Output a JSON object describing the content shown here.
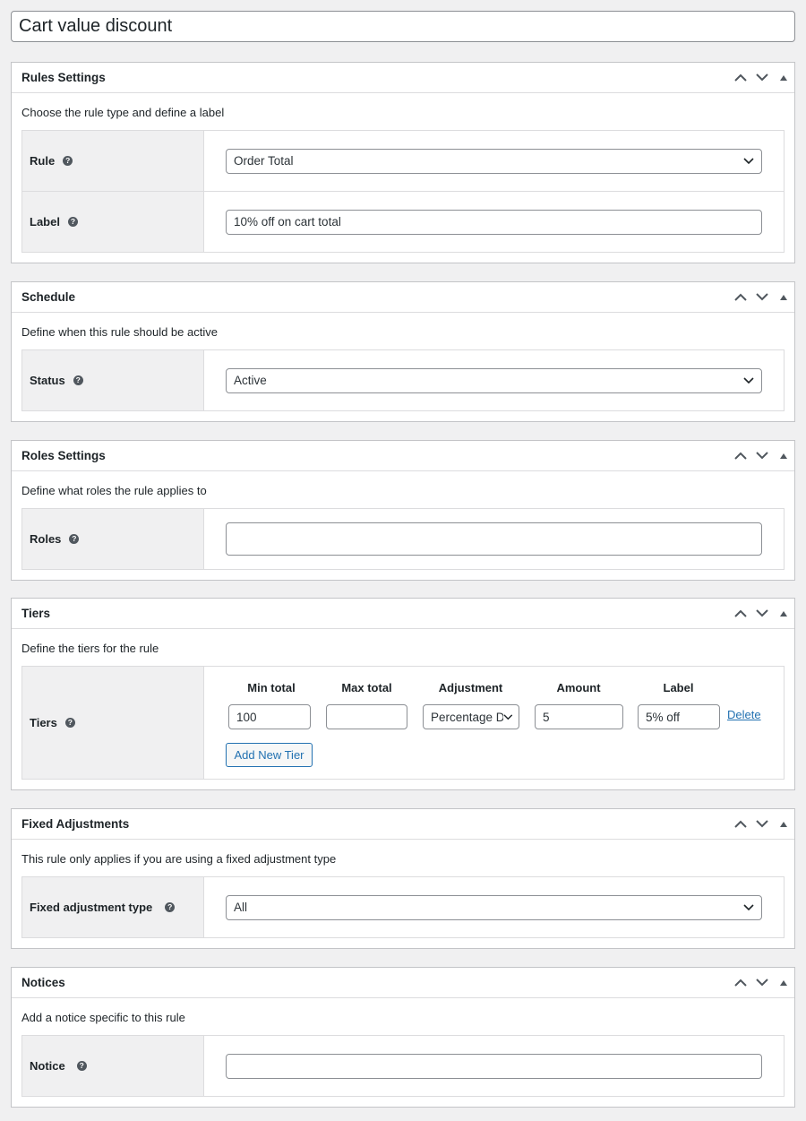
{
  "title": "Cart value discount",
  "rules_settings": {
    "title": "Rules Settings",
    "description": "Choose the rule type and define a label",
    "rule_label": "Rule",
    "rule_value": "Order Total",
    "label_label": "Label",
    "label_value": "10% off on cart total"
  },
  "schedule": {
    "title": "Schedule",
    "description": "Define when this rule should be active",
    "status_label": "Status",
    "status_value": "Active"
  },
  "roles_settings": {
    "title": "Roles Settings",
    "description": "Define what roles the rule applies to",
    "roles_label": "Roles",
    "roles_value": ""
  },
  "tiers": {
    "title": "Tiers",
    "description": "Define the tiers for the rule",
    "tiers_label": "Tiers",
    "columns": [
      "Min total",
      "Max total",
      "Adjustment",
      "Amount",
      "Label"
    ],
    "rows": [
      {
        "min_total": "100",
        "max_total": "",
        "adjustment": "Percentage D",
        "amount": "5",
        "label": "5% off",
        "delete": "Delete"
      }
    ],
    "add_button": "Add New Tier"
  },
  "fixed_adjustments": {
    "title": "Fixed Adjustments",
    "description": "This rule only applies if you are using a fixed adjustment type",
    "type_label": "Fixed adjustment type",
    "type_value": "All"
  },
  "notices": {
    "title": "Notices",
    "description": "Add a notice specific to this rule",
    "notice_label": "Notice",
    "notice_value": ""
  },
  "help_glyph": "?",
  "colors": {
    "link": "#2271b1",
    "border": "#c3c4c7",
    "label_bg": "#f0f0f1"
  }
}
